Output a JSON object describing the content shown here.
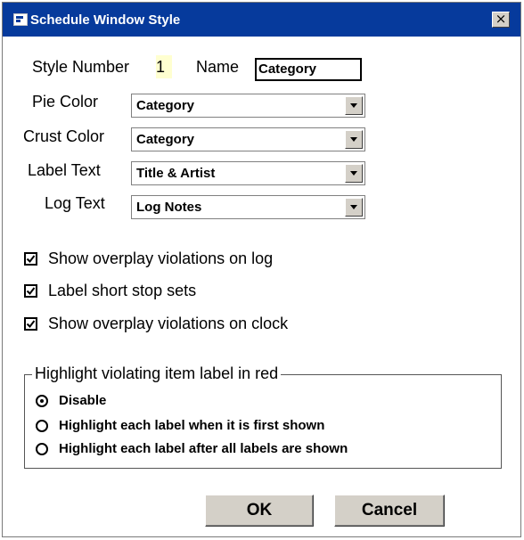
{
  "window": {
    "title": "Schedule Window Style",
    "close_label": "×"
  },
  "style_number": {
    "label": "Style Number",
    "value": "1"
  },
  "name": {
    "label": "Name",
    "value": "Category"
  },
  "fields": [
    {
      "label": "Pie Color",
      "value": "Category"
    },
    {
      "label": "Crust Color",
      "value": "Category"
    },
    {
      "label": "Label Text",
      "value": "Title & Artist"
    },
    {
      "label": "Log Text",
      "value": "Log Notes"
    }
  ],
  "checkboxes": [
    {
      "label": "Show overplay violations on log",
      "checked": true
    },
    {
      "label": "Label short stop sets",
      "checked": true
    },
    {
      "label": "Show overplay violations on clock",
      "checked": true
    }
  ],
  "highlight_group": {
    "title": "Highlight violating item label in red",
    "options": [
      {
        "label": "Disable",
        "selected": true
      },
      {
        "label": "Highlight each label when it is first shown",
        "selected": false
      },
      {
        "label": "Highlight each label after all labels are shown",
        "selected": false
      }
    ]
  },
  "buttons": {
    "ok": "OK",
    "cancel": "Cancel"
  },
  "colors": {
    "titlebar": "#063a9c",
    "highlight_value_bg": "#ffffd0",
    "button_face": "#d4d0c8"
  }
}
